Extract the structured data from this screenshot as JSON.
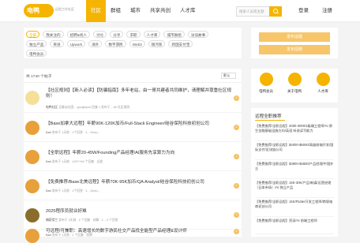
{
  "header": {
    "logo_text": "电鸭",
    "logo_subtitle": "远程工作社区",
    "nav": [
      "社区",
      "群组",
      "城市",
      "共享共创",
      "人才库"
    ],
    "search_placeholder": "搜索人员或主题",
    "login": "登录",
    "register": "注册",
    "accent": "#f5b400"
  },
  "tags": {
    "row1": [
      "全部",
      "我关注的",
      "招聘&找人",
      "讨论",
      "分享",
      "求职",
      "人才库",
      "城市群组",
      "访谈故事"
    ],
    "row2": [
      "独立产品",
      "英语",
      "Upwork",
      "海外",
      "数字游民",
      "Web3",
      "银河系",
      "跨国支付宝"
    ],
    "row3": [
      "电鸭会员"
    ]
  },
  "actions": {
    "post_button": "发布话题",
    "invite_button": "发布招聘"
  },
  "features": [
    {
      "label": "电鸭会员",
      "icon": "member-icon"
    },
    {
      "label": "关于电鸭",
      "icon": "duck-icon"
    },
    {
      "label": "人才库",
      "icon": "talent-icon"
    }
  ],
  "list": {
    "count": "共 1740 个帖子",
    "sort": "默认",
    "posts": [
      {
        "title": "【社区规则】【新人必读】【防骗指南】多年老站，由一哥共建者共同维护，请理解并尊重社区规则！",
        "author": "电鸭社区",
        "meta": "无聊@社团... googlepod 回复 1 发布于... 8h 社区规则",
        "reply": "4"
      },
      {
        "title": "【Base加拿大远程】年薪90K-120K加币/Full-Stack Engineer/硅谷保险科技初创公司",
        "author": "Kari",
        "meta": "发布于 1天前 · 1个回答 · 1... Deep...",
        "reply": "2"
      },
      {
        "title": "【全职远程】年薪20-45W/Founding产品经理/AI服务先享算力为向",
        "author": "Kari",
        "meta": "发布于 1天前 · 100***/W 个回复 · 远程",
        "reply": "1"
      },
      {
        "title": "【免费推荐/Base北美远程】年薪70K-95K加币/QA Analyst/硅谷保险科技初创公司",
        "author": "Kari",
        "meta": "发布于 1天前 · 1个回答 · 1... Deep...",
        "reply": "2"
      },
      {
        "title": "2025程序员就业好难",
        "author": "捕获荷兰",
        "meta": "发布于 3天前 · 2 个回复 · 闲聊 · 1... 3 个回答",
        "reply": "3"
      },
      {
        "title": "可远程/可兼职：高速增长的数字游民社交产品找全能型产品经理&设计师",
        "author": "Kari",
        "meta": "发布于 1天前 · 2 个回复 · 招聘",
        "reply": "2"
      }
    ]
  },
  "jobs": {
    "title": "远程全职推荐",
    "items": [
      "【免费推荐/全职远程】4000-3000/1级端工程师/AI 原生金融基础设施方向/英语 听说读写能力",
      "【免费推荐/全职远程】$4000-$6000/高级前端开发/国际支付/区块链公司",
      "【免费推荐/全职远程】$3900-$4800/产品经理/中国外企",
      "【免费推荐/全职远程】15K-30K/产品/新媒/运营经理（日本市场）/AI 独立产品",
      "【免费推荐/全职远程】15K/Flutter开发工程师/跨境电商初创公司",
      "【免费推荐/全职远程】资深/AI 前端工程师"
    ]
  }
}
